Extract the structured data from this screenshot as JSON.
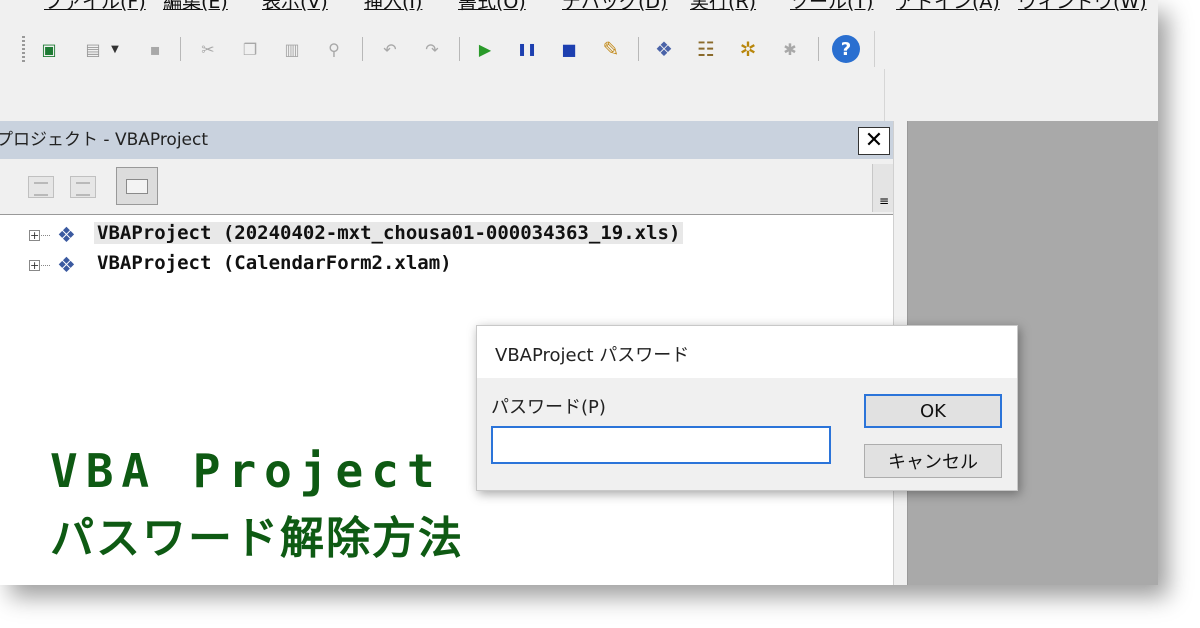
{
  "menu": [
    {
      "label": "ファイル(F)"
    },
    {
      "label": "編集(E)"
    },
    {
      "label": "表示(V)"
    },
    {
      "label": "挿入(I)"
    },
    {
      "label": "書式(O)"
    },
    {
      "label": "デバッグ(D)"
    },
    {
      "label": "実行(R)"
    },
    {
      "label": "ツール(T)"
    },
    {
      "label": "アドイン(A)"
    },
    {
      "label": "ウィンドウ(W)"
    }
  ],
  "toolbar": {
    "icons": [
      {
        "name": "excel-icon",
        "glyph": "▣",
        "color": "#1e7b34"
      },
      {
        "name": "insert-form-icon",
        "glyph": "▤",
        "color": "#9a9a9a"
      },
      {
        "name": "save-icon",
        "glyph": "▪",
        "color": "#a8a8a8"
      },
      {
        "name": "cut-icon",
        "glyph": "✂",
        "color": "#a8a8a8"
      },
      {
        "name": "copy-icon",
        "glyph": "❐",
        "color": "#a8a8a8"
      },
      {
        "name": "paste-icon",
        "glyph": "▥",
        "color": "#a8a8a8"
      },
      {
        "name": "find-icon",
        "glyph": "⚲",
        "color": "#a8a8a8"
      },
      {
        "name": "undo-icon",
        "glyph": "↶",
        "color": "#a8a8a8"
      },
      {
        "name": "redo-icon",
        "glyph": "↷",
        "color": "#a8a8a8"
      },
      {
        "name": "run-icon",
        "glyph": "▶",
        "color": "#2a9a2a"
      },
      {
        "name": "break-icon",
        "glyph": "❚❚",
        "color": "#1d3fb0"
      },
      {
        "name": "reset-icon",
        "glyph": "■",
        "color": "#1d3fb0"
      },
      {
        "name": "design-mode-icon",
        "glyph": "✎",
        "color": "#c28a1a"
      },
      {
        "name": "project-explorer-icon",
        "glyph": "❖",
        "color": "#4a63a8"
      },
      {
        "name": "properties-icon",
        "glyph": "☷",
        "color": "#8a6a2a"
      },
      {
        "name": "object-browser-icon",
        "glyph": "✲",
        "color": "#b8860b"
      },
      {
        "name": "toolbox-icon",
        "glyph": "✱",
        "color": "#a8a8a8"
      },
      {
        "name": "help-icon",
        "glyph": "?",
        "color": "#2a6fd0"
      }
    ]
  },
  "project_pane": {
    "title": "プロジェクト - VBAProject",
    "close_glyph": "✕",
    "scroll_glyph": "≡",
    "tree": [
      {
        "label": "VBAProject (20240402-mxt_chousa01-000034363_19.xls)"
      },
      {
        "label": "VBAProject (CalendarForm2.xlam)"
      }
    ]
  },
  "dialog": {
    "title": "VBAProject パスワード",
    "field_label": "パスワード(P)",
    "field_value": "",
    "ok_label": "OK",
    "cancel_label": "キャンセル"
  },
  "overlay": {
    "line1": "VBA Project",
    "line2": "パスワード解除方法",
    "color": "#0e5a13"
  }
}
